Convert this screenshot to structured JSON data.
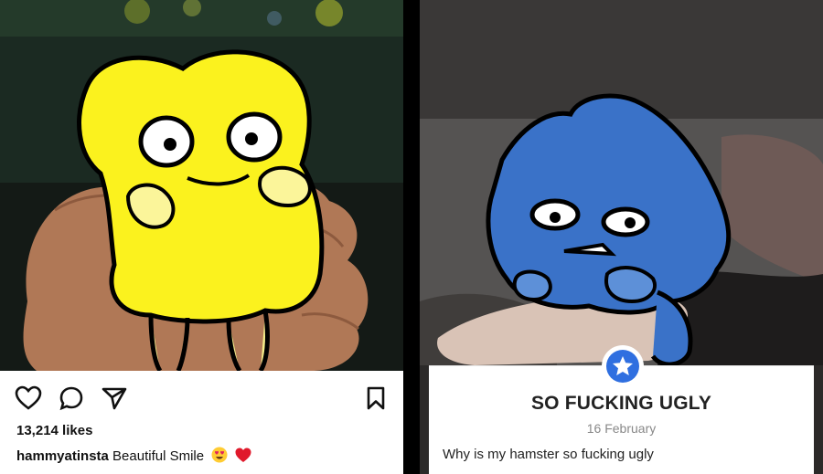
{
  "left_post": {
    "likes": "13,214 likes",
    "username": "hammyatinsta",
    "caption": "Beautiful Smile",
    "icons": [
      "heart-icon",
      "comment-icon",
      "share-icon",
      "bookmark-icon",
      "heart-eyes-emoji-icon",
      "red-heart-emoji-icon"
    ]
  },
  "right_post": {
    "title": "SO FUCKING UGLY",
    "date": "16 February",
    "body": "Why is my hamster so fucking ugly",
    "icons": [
      "star-badge-icon"
    ]
  },
  "colors": {
    "yellow_character": "#fbf21e",
    "blue_character": "#3a72c8",
    "badge_blue": "#2f6fe0"
  }
}
